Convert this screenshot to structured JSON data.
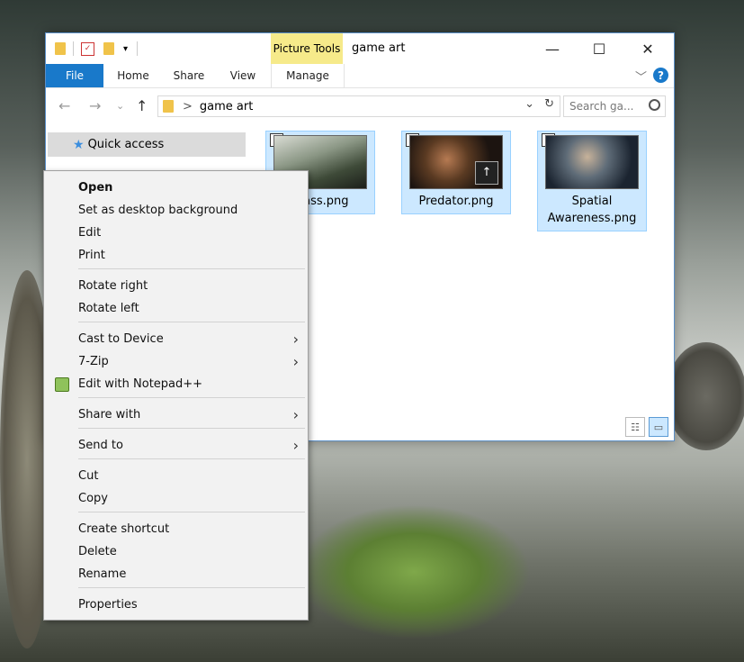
{
  "window": {
    "title": "game art",
    "picture_tools_label": "Picture Tools",
    "controls": {
      "minimize": "—",
      "maximize": "☐",
      "close": "✕"
    }
  },
  "ribbon": {
    "tabs": [
      "File",
      "Home",
      "Share",
      "View",
      "Manage"
    ],
    "collapse": "﹀",
    "help": "?"
  },
  "address": {
    "separator": ">",
    "path": "game art",
    "search_placeholder": "Search ga...",
    "dropdown": "⌄",
    "refresh": "↻"
  },
  "nav": {
    "back": "←",
    "forward": "→",
    "history": "⌄",
    "up": "↑"
  },
  "navpane": {
    "quick_access": "Quick access"
  },
  "files": [
    {
      "name": "Class.png",
      "checked": "✓"
    },
    {
      "name": "Predator.png",
      "checked": "✓"
    },
    {
      "name": "Spatial Awareness.png",
      "checked": "✓"
    }
  ],
  "view_buttons": {
    "details": "☷",
    "large_icons": "▭"
  },
  "context_menu": {
    "items": [
      {
        "label": "Open",
        "bold": true
      },
      {
        "label": "Set as desktop background"
      },
      {
        "label": "Edit"
      },
      {
        "label": "Print"
      },
      {
        "label": "Rotate right"
      },
      {
        "label": "Rotate left"
      },
      {
        "label": "Cast to Device",
        "submenu": "›"
      },
      {
        "label": "7-Zip",
        "submenu": "›"
      },
      {
        "label": "Edit with Notepad++"
      },
      {
        "label": "Share with",
        "submenu": "›"
      },
      {
        "label": "Send to",
        "submenu": "›"
      },
      {
        "label": "Cut"
      },
      {
        "label": "Copy"
      },
      {
        "label": "Create shortcut"
      },
      {
        "label": "Delete"
      },
      {
        "label": "Rename"
      },
      {
        "label": "Properties"
      }
    ]
  },
  "colors": {
    "accent": "#1979ca",
    "selection": "#cce8ff",
    "picture_tools": "#f6ea8a"
  }
}
